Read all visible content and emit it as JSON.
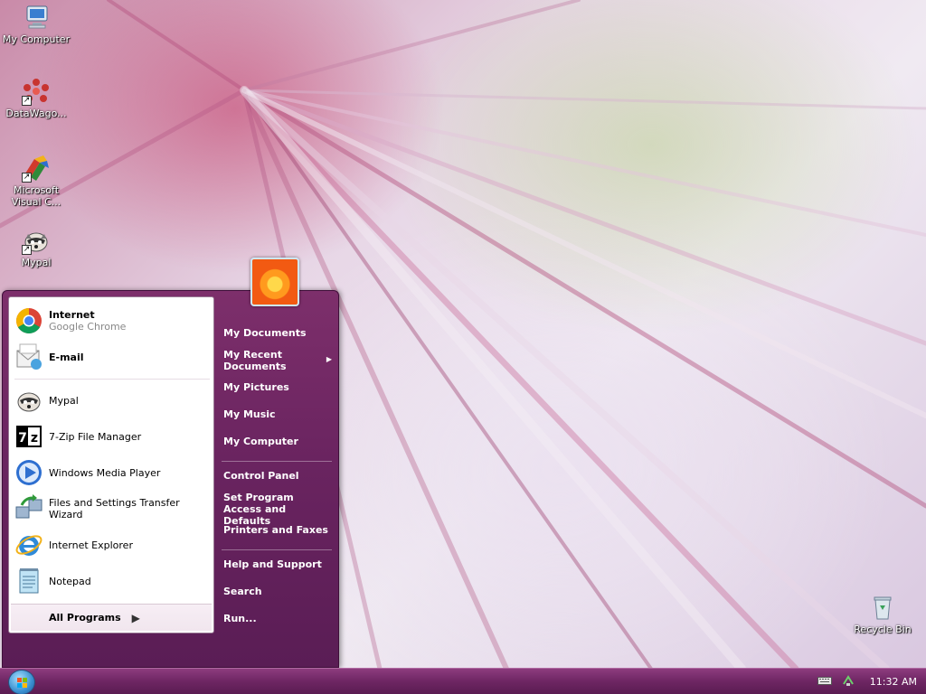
{
  "desktop": {
    "icons": [
      {
        "label": "My Computer",
        "icon": "my-computer-icon"
      },
      {
        "label": "DataWago...",
        "icon": "datawagon-icon"
      },
      {
        "label": "Microsoft Visual C...",
        "icon": "visual-studio-icon"
      },
      {
        "label": "Mypal",
        "icon": "mypal-icon"
      },
      {
        "label": "Recycle Bin",
        "icon": "recycle-bin-icon"
      }
    ]
  },
  "start_menu": {
    "pinned": [
      {
        "title": "Internet",
        "subtitle": "Google Chrome",
        "icon": "chrome-icon"
      },
      {
        "title": "E-mail",
        "icon": "email-icon"
      }
    ],
    "recent": [
      {
        "label": "Mypal",
        "icon": "mypal-icon"
      },
      {
        "label": "7-Zip File Manager",
        "icon": "7zip-icon"
      },
      {
        "label": "Windows Media Player",
        "icon": "media-player-icon"
      },
      {
        "label": "Files and Settings Transfer Wizard",
        "icon": "transfer-wizard-icon"
      },
      {
        "label": "Internet Explorer",
        "icon": "internet-explorer-icon"
      },
      {
        "label": "Notepad",
        "icon": "notepad-icon"
      }
    ],
    "all_programs": "All Programs",
    "places": [
      "My Documents",
      "My Recent Documents",
      "My Pictures",
      "My Music",
      "My Computer",
      "Control Panel",
      "Set Program Access and Defaults",
      "Printers and Faxes",
      "Help and Support",
      "Search",
      "Run..."
    ]
  },
  "taskbar": {
    "clock": "11:32 AM"
  }
}
